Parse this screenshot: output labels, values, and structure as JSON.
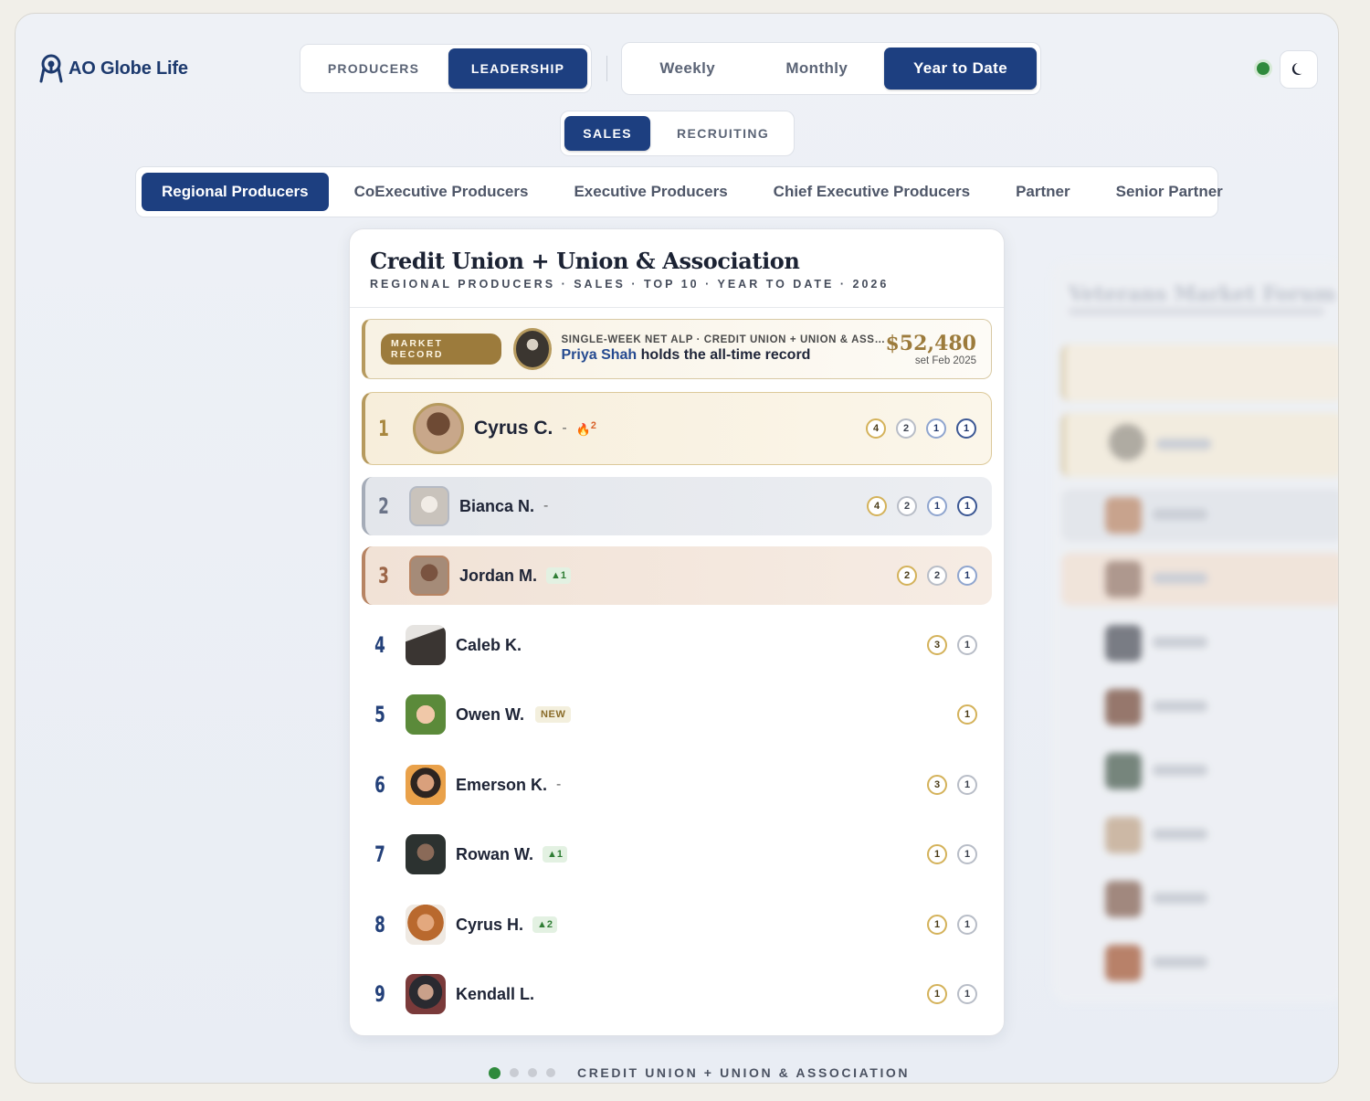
{
  "brand": {
    "name": "AO Globe Life"
  },
  "role_tabs": [
    {
      "label": "PRODUCERS",
      "active": false
    },
    {
      "label": "LEADERSHIP",
      "active": true
    }
  ],
  "period_tabs": [
    {
      "label": "Weekly",
      "active": false
    },
    {
      "label": "Monthly",
      "active": false
    },
    {
      "label": "Year to Date",
      "active": true
    }
  ],
  "kind_tabs": [
    {
      "label": "SALES",
      "active": true
    },
    {
      "label": "RECRUITING",
      "active": false
    }
  ],
  "tier_tabs": [
    {
      "label": "Regional Producers",
      "active": true
    },
    {
      "label": "CoExecutive Producers",
      "active": false
    },
    {
      "label": "Executive Producers",
      "active": false
    },
    {
      "label": "Chief Executive Producers",
      "active": false
    },
    {
      "label": "Partner",
      "active": false
    },
    {
      "label": "Senior Partner",
      "active": false
    }
  ],
  "icons": {
    "logo": "globe-pin-icon",
    "theme": "moon-icon",
    "status": "live-status-dot",
    "streak": "fire-icon"
  },
  "colors": {
    "accent": "#1d3f80",
    "gold": "#b69a5e",
    "silver": "#a5acb8",
    "bronze": "#b78463",
    "live": "#2f8a3c"
  },
  "board": {
    "title": "Credit Union + Union & Association",
    "subtitle": "REGIONAL PRODUCERS · SALES · TOP 10 · YEAR TO DATE · 2026",
    "record": {
      "badge": "MARKET RECORD",
      "meta": "SINGLE-WEEK NET ALP · CREDIT UNION + UNION & ASSOCIATION",
      "holder": "Priya Shah",
      "holder_suffix": "holds the all-time record",
      "amount": "$52,480",
      "date": "set Feb 2025"
    },
    "rows": [
      {
        "rank": "1",
        "name": "Cyrus C.",
        "dash": "-",
        "streak": "2",
        "medals": [
          "4",
          "2",
          "1",
          "1"
        ]
      },
      {
        "rank": "2",
        "name": "Bianca N.",
        "dash": "-",
        "medals": [
          "4",
          "2",
          "1",
          "1"
        ]
      },
      {
        "rank": "3",
        "name": "Jordan M.",
        "change": "▲1",
        "medals": [
          "2",
          "2",
          "1"
        ]
      },
      {
        "rank": "4",
        "name": "Caleb K.",
        "medals": [
          "3",
          "1"
        ]
      },
      {
        "rank": "5",
        "name": "Owen W.",
        "tag": "NEW",
        "medals": [
          "1"
        ]
      },
      {
        "rank": "6",
        "name": "Emerson K.",
        "dash": "-",
        "medals": [
          "3",
          "1"
        ]
      },
      {
        "rank": "7",
        "name": "Rowan W.",
        "change": "▲1",
        "medals": [
          "1",
          "1"
        ]
      },
      {
        "rank": "8",
        "name": "Cyrus H.",
        "change": "▲2",
        "medals": [
          "1",
          "1"
        ]
      },
      {
        "rank": "9",
        "name": "Kendall L.",
        "medals": [
          "1",
          "1"
        ]
      }
    ]
  },
  "next_board": {
    "title": "Veterans Market Forum"
  },
  "pager": {
    "label": "CREDIT UNION + UNION & ASSOCIATION",
    "pages": 4,
    "current": 1
  }
}
